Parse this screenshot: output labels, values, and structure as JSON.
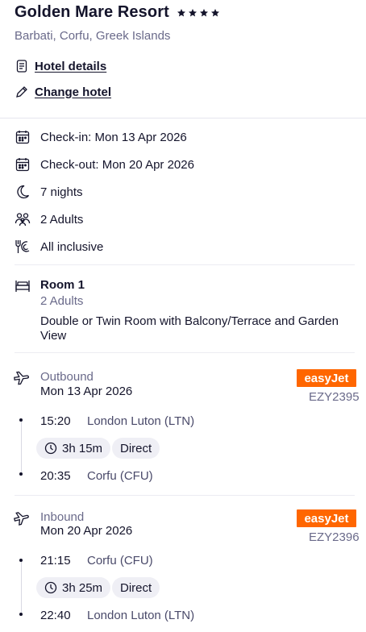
{
  "hotel": {
    "name": "Golden Mare Resort",
    "stars": 4,
    "location": "Barbati, Corfu, Greek Islands"
  },
  "links": {
    "details": "Hotel details",
    "change": "Change hotel"
  },
  "stay": {
    "checkin": "Check-in: Mon 13 Apr 2026",
    "checkout": "Check-out: Mon 20 Apr 2026",
    "nights": "7 nights",
    "guests": "2 Adults",
    "board": "All inclusive"
  },
  "room": {
    "title": "Room 1",
    "guests": "2 Adults",
    "description": "Double or Twin Room with Balcony/Terrace and Garden View"
  },
  "outbound": {
    "label": "Outbound",
    "date": "Mon 13 Apr 2026",
    "airline": "easyJet",
    "flight_no": "EZY2395",
    "depart_time": "15:20",
    "depart_airport": "London Luton (LTN)",
    "duration": "3h 15m",
    "stops": "Direct",
    "arrive_time": "20:35",
    "arrive_airport": "Corfu (CFU)"
  },
  "inbound": {
    "label": "Inbound",
    "date": "Mon 20 Apr 2026",
    "airline": "easyJet",
    "flight_no": "EZY2396",
    "depart_time": "21:15",
    "depart_airport": "Corfu (CFU)",
    "duration": "3h 25m",
    "stops": "Direct",
    "arrive_time": "22:40",
    "arrive_airport": "London Luton (LTN)"
  },
  "colors": {
    "text": "#14142b",
    "muted": "#6a6a8a",
    "easyjet": "#ff6600"
  }
}
